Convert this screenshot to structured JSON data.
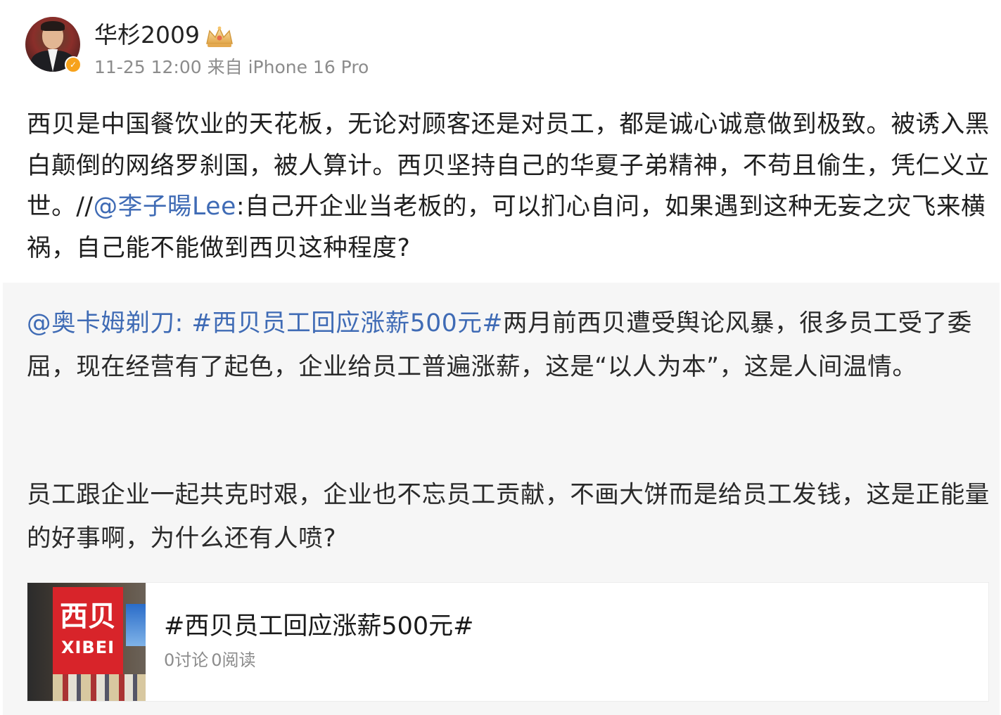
{
  "post": {
    "author": {
      "name": "华杉2009",
      "badge_icon": "crown-icon",
      "verified_icon": "verified-badge-icon"
    },
    "meta": {
      "time": "11-25 12:00",
      "source": "来自 iPhone 16 Pro"
    },
    "text": {
      "part1": "西贝是中国餐饮业的天花板，无论对顾客还是对员工，都是诚心诚意做到极致。被诱入黑白颠倒的网络罗刹国，被人算计。西贝坚持自己的华夏子弟精神，不苟且偷生，凭仁义立世。//",
      "mention": "@李子暘Lee",
      "part2": ":自己开企业当老板的，可以扪心自问，如果遇到这种无妄之灾飞来横祸，自己能不能做到西贝这种程度?"
    }
  },
  "repost": {
    "mention": "@奥卡姆剃刀:",
    "hashtag": " #西贝员工回应涨薪500元#",
    "text1": "两月前西贝遭受舆论风暴，很多员工受了委屈，现在经营有了起色，企业给员工普遍涨薪，这是“以人为本”，这是人间温情。",
    "text2": "员工跟企业一起共克时艰，企业也不忘员工贡献，不画大饼而是给员工发钱，这是正能量的好事啊，为什么还有人喷?"
  },
  "topic_card": {
    "thumb_sign_cn": "西贝",
    "thumb_sign_en": "XIBEI",
    "title": "#西贝员工回应涨薪500元#",
    "discussions": "0讨论",
    "reads": "0阅读"
  },
  "colors": {
    "link": "#3f6bb5",
    "meta": "#8c8c8c",
    "repost_bg": "#f6f6f6",
    "brand_red": "#d8242a"
  }
}
